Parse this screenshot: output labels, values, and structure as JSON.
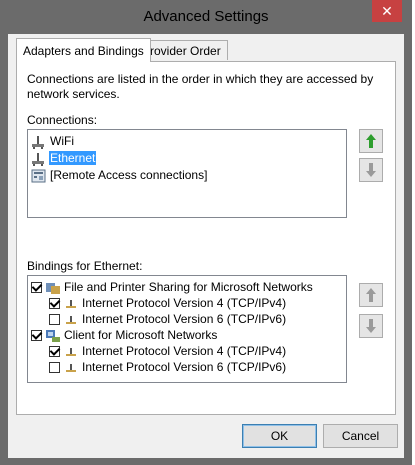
{
  "window": {
    "title": "Advanced Settings",
    "close_glyph": "✕"
  },
  "tabs": [
    {
      "label": "Adapters and Bindings",
      "active": true
    },
    {
      "label": "Provider Order",
      "active": false
    }
  ],
  "description": "Connections are listed in the order in which they are accessed by network services.",
  "connections": {
    "label": "Connections:",
    "items": [
      {
        "label": "WiFi",
        "icon": "network-adapter-icon",
        "selected": false
      },
      {
        "label": "Ethernet",
        "icon": "network-adapter-icon",
        "selected": true
      },
      {
        "label": "[Remote Access connections]",
        "icon": "remote-access-icon",
        "selected": false
      }
    ]
  },
  "bindings": {
    "label": "Bindings for Ethernet:",
    "items": [
      {
        "label": "File and Printer Sharing for Microsoft Networks",
        "checked": true,
        "level": 0,
        "icon": "service-icon"
      },
      {
        "label": "Internet Protocol Version 4 (TCP/IPv4)",
        "checked": true,
        "level": 1,
        "icon": "protocol-icon"
      },
      {
        "label": "Internet Protocol Version 6 (TCP/IPv6)",
        "checked": false,
        "level": 1,
        "icon": "protocol-icon"
      },
      {
        "label": "Client for Microsoft Networks",
        "checked": true,
        "level": 0,
        "icon": "client-icon"
      },
      {
        "label": "Internet Protocol Version 4 (TCP/IPv4)",
        "checked": true,
        "level": 1,
        "icon": "protocol-icon"
      },
      {
        "label": "Internet Protocol Version 6 (TCP/IPv6)",
        "checked": false,
        "level": 1,
        "icon": "protocol-icon"
      }
    ]
  },
  "buttons": {
    "ok": "OK",
    "cancel": "Cancel"
  },
  "colors": {
    "selection": "#3399ff",
    "arrow_enabled": "#2e9e2e",
    "arrow_disabled": "#9a9a9a",
    "title_bar": "#6b6b6b",
    "close": "#c74141"
  }
}
